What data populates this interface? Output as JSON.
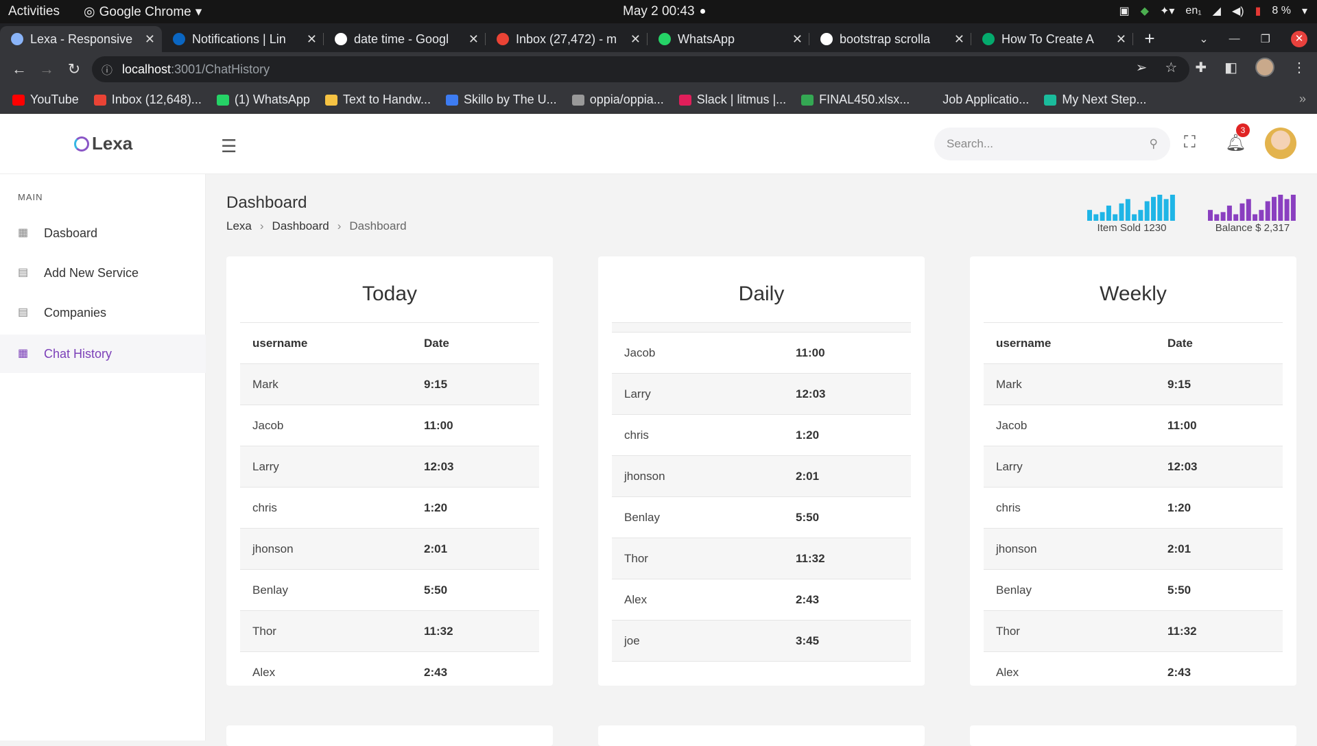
{
  "os": {
    "activities": "Activities",
    "app": "Google Chrome",
    "clock": "May 2  00:43",
    "lang": "en₁",
    "battery": "8 %"
  },
  "tabs": [
    {
      "title": "Lexa - Responsive",
      "color": "#8ab4f8"
    },
    {
      "title": "Notifications | Lin",
      "color": "#0a66c2"
    },
    {
      "title": "date time - Googl",
      "color": "#ffffff"
    },
    {
      "title": "Inbox (27,472) - m",
      "color": "#ea4335"
    },
    {
      "title": "WhatsApp",
      "color": "#25d366"
    },
    {
      "title": "bootstrap scrolla",
      "color": "#ffffff"
    },
    {
      "title": "How To Create A",
      "color": "#04aa6d"
    }
  ],
  "address": {
    "host": "localhost",
    "path": ":3001/ChatHistory"
  },
  "bookmarks": [
    {
      "label": "YouTube",
      "color": "#ff0000"
    },
    {
      "label": "Inbox (12,648)...",
      "color": "#ea4335"
    },
    {
      "label": "(1) WhatsApp",
      "color": "#25d366"
    },
    {
      "label": "Text to Handw...",
      "color": "#f6c343"
    },
    {
      "label": "Skillo by The U...",
      "color": "#3d7cf2"
    },
    {
      "label": "oppia/oppia...",
      "color": "#999999"
    },
    {
      "label": "Slack | litmus |...",
      "color": "#e01e5a"
    },
    {
      "label": "FINAL450.xlsx...",
      "color": "#34a853"
    },
    {
      "label": "Job Applicatio...",
      "color": "#35363a"
    },
    {
      "label": "My Next Step...",
      "color": "#1abc9c"
    }
  ],
  "app": {
    "logo": "Lexa",
    "search_placeholder": "Search...",
    "notif_count": "3",
    "sidebar": {
      "section": "MAIN",
      "items": [
        "Dasboard",
        "Add New Service",
        "Companies",
        "Chat History"
      ]
    },
    "page_title": "Dashboard",
    "breadcrumb": [
      "Lexa",
      "Dashboard",
      "Dashboard"
    ],
    "stats": [
      {
        "label": "Item Sold 1230",
        "color": "#1fb5e6",
        "bars": [
          5,
          3,
          4,
          7,
          3,
          8,
          10,
          3,
          5,
          9,
          11,
          12,
          10,
          12
        ]
      },
      {
        "label": "Balance $ 2,317",
        "color": "#8a3fc0",
        "bars": [
          5,
          3,
          4,
          7,
          3,
          8,
          10,
          3,
          5,
          9,
          11,
          12,
          10,
          12
        ]
      }
    ],
    "cards": [
      {
        "title": "Today",
        "headers": [
          "username",
          "Date"
        ],
        "rows": [
          [
            "Mark",
            "9:15"
          ],
          [
            "Jacob",
            "11:00"
          ],
          [
            "Larry",
            "12:03"
          ],
          [
            "chris",
            "1:20"
          ],
          [
            "jhonson",
            "2:01"
          ],
          [
            "Benlay",
            "5:50"
          ],
          [
            "Thor",
            "11:32"
          ],
          [
            "Alex",
            "2:43"
          ]
        ]
      },
      {
        "title": "Daily",
        "headers": [],
        "rows": [
          [
            "Jacob",
            "11:00"
          ],
          [
            "Larry",
            "12:03"
          ],
          [
            "chris",
            "1:20"
          ],
          [
            "jhonson",
            "2:01"
          ],
          [
            "Benlay",
            "5:50"
          ],
          [
            "Thor",
            "11:32"
          ],
          [
            "Alex",
            "2:43"
          ],
          [
            "joe",
            "3:45"
          ]
        ]
      },
      {
        "title": "Weekly",
        "headers": [
          "username",
          "Date"
        ],
        "rows": [
          [
            "Mark",
            "9:15"
          ],
          [
            "Jacob",
            "11:00"
          ],
          [
            "Larry",
            "12:03"
          ],
          [
            "chris",
            "1:20"
          ],
          [
            "jhonson",
            "2:01"
          ],
          [
            "Benlay",
            "5:50"
          ],
          [
            "Thor",
            "11:32"
          ],
          [
            "Alex",
            "2:43"
          ]
        ]
      }
    ]
  }
}
